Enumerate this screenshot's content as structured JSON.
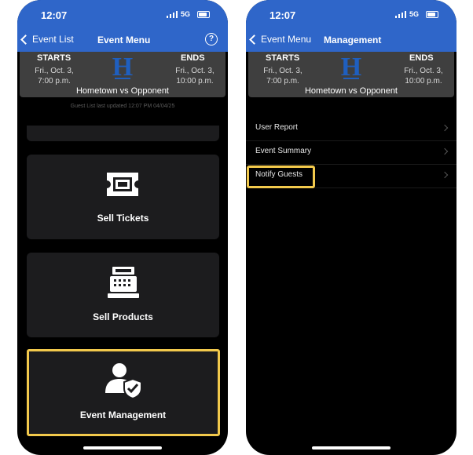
{
  "status_bar": {
    "time": "12:07",
    "network": "5G"
  },
  "event": {
    "starts_label": "STARTS",
    "starts_date": "Fri., Oct. 3,",
    "starts_time": "7:00 p.m.",
    "ends_label": "ENDS",
    "ends_date": "Fri., Oct. 3,",
    "ends_time": "10:00 p.m.",
    "matchup": "Hometown vs Opponent",
    "logo_letter": "H"
  },
  "left_screen": {
    "back_label": "Event List",
    "title": "Event Menu",
    "help_label": "?",
    "updated_text": "Guest List last updated 12:07 PM 04/04/25",
    "tiles": [
      {
        "label": "Sell Tickets",
        "icon": "ticket-icon"
      },
      {
        "label": "Sell Products",
        "icon": "cash-register-icon"
      },
      {
        "label": "Event Management",
        "icon": "user-shield-icon",
        "highlighted": true
      }
    ]
  },
  "right_screen": {
    "back_label": "Event Menu",
    "title": "Management",
    "items": [
      {
        "label": "User Report"
      },
      {
        "label": "Event Summary"
      },
      {
        "label": "Notify Guests",
        "highlighted": true
      }
    ]
  },
  "colors": {
    "nav_bar": "#2f66c9",
    "highlight": "#f2c94c",
    "tile_background": "#1c1c1e",
    "logo": "#1f5fbf"
  }
}
